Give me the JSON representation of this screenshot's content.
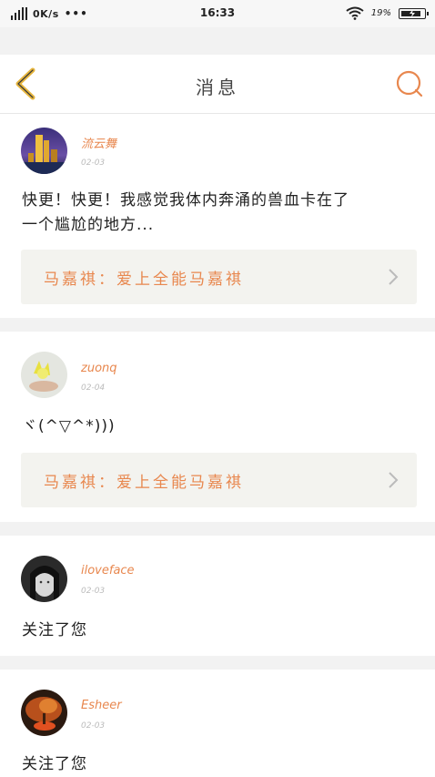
{
  "status_bar": {
    "network_speed": "0K/s",
    "more_dots": "•••",
    "time": "16:33",
    "battery_percent": "19%",
    "battery_level": 0.9
  },
  "header": {
    "title": "消息",
    "back_icon": "chevron-left-icon",
    "search_icon": "search-icon"
  },
  "colors": {
    "accent": "#e8874e",
    "back": "#e7b63d"
  },
  "messages": [
    {
      "user": "流云舞",
      "date": "02-03",
      "text_line1": "快更！快更！我感觉我体内奔涌的兽血卡在了",
      "text_line2": "一个尴尬的地方...",
      "quote": "马嘉祺：爱上全能马嘉祺"
    },
    {
      "user": "zuonq",
      "date": "02-04",
      "text_line1": "ヾ(^▽^*)))",
      "quote": "马嘉祺：爱上全能马嘉祺"
    },
    {
      "user": "iloveface",
      "date": "02-03",
      "text_line1": "关注了您"
    },
    {
      "user": "Esheer",
      "date": "02-03",
      "text_line1": "关注了您"
    }
  ]
}
